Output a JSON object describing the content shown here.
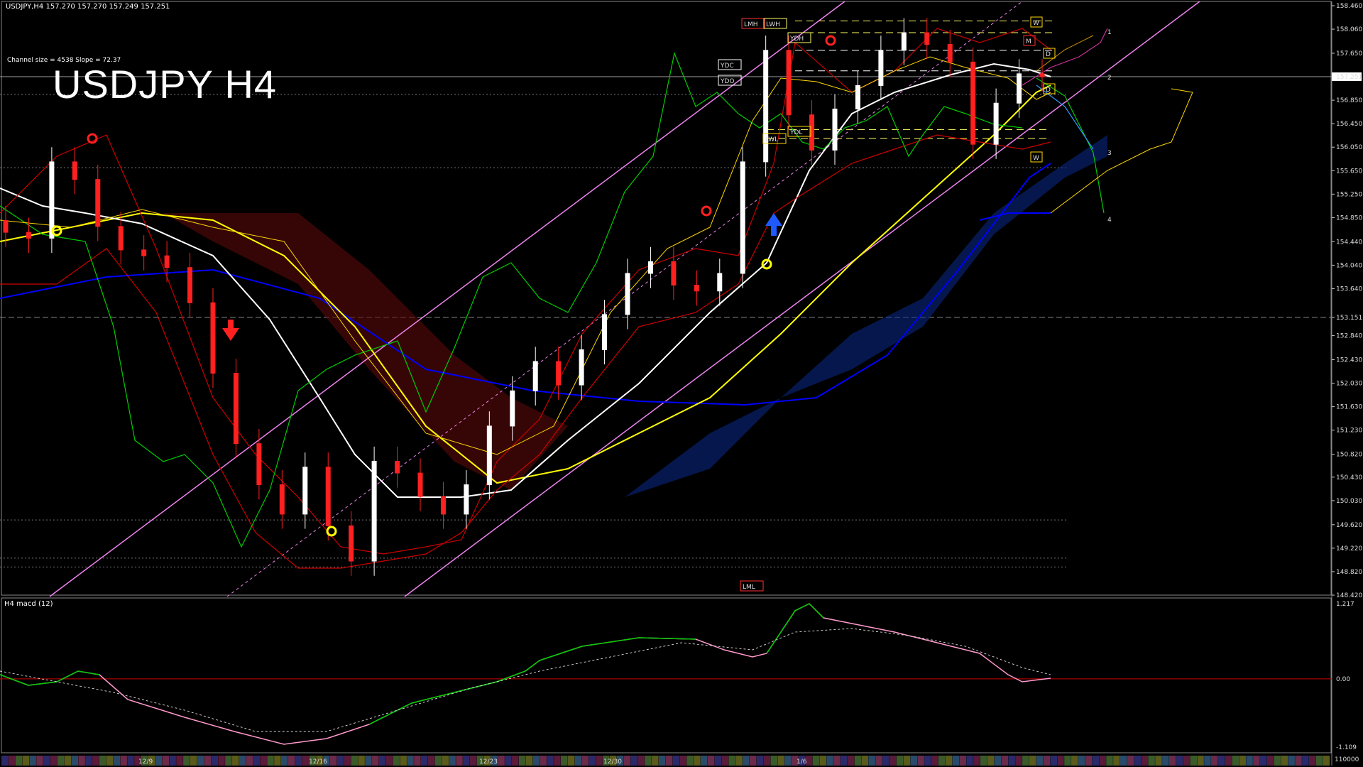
{
  "header": {
    "symbol_line": "USDJPY,H4  157.270 157.270 157.249 157.251",
    "channel_info": "Channel size = 4538 Slope = 72.37",
    "big_title": "USDJPY H4"
  },
  "price_axis": {
    "ticks": [
      "158.460",
      "158.060",
      "157.650",
      "157.251",
      "156.850",
      "156.450",
      "156.050",
      "155.650",
      "155.250",
      "154.850",
      "154.440",
      "154.040",
      "153.640",
      "153.151",
      "152.840",
      "152.430",
      "152.030",
      "151.630",
      "151.230",
      "150.820",
      "150.430",
      "150.030",
      "149.620",
      "149.220",
      "148.820",
      "148.420"
    ],
    "current_price": "157.251",
    "ref_price": "153.151"
  },
  "macd_panel": {
    "label": "H4  macd (12)",
    "ticks": [
      "1.217",
      "0.00",
      "-1.109"
    ],
    "volume_label": "110000"
  },
  "time_axis": {
    "labels": [
      "12/9",
      "12/16",
      "12/23",
      "12/30",
      "1/6"
    ]
  },
  "markers": {
    "lmh": "LMH",
    "lwh": "LWH",
    "ydh": "YDH",
    "ydc": "YDC",
    "ydo": "YDO",
    "lwl": "LWL",
    "ydl": "YDL",
    "lml": "LML",
    "w": "W",
    "m": "M",
    "d": "D",
    "wave": [
      "1",
      "2",
      "3",
      "4"
    ]
  },
  "colors": {
    "bull": "#ffffff",
    "bear": "#ff0000",
    "ma_white": "#ffffff",
    "ma_yellow": "#ffff00",
    "ma_blue": "#0000ff",
    "channel": "#ee82ee",
    "green": "#00cc00",
    "cloud": "#1e5aff"
  },
  "chart_data": {
    "type": "candlestick",
    "y_axis_range": [
      148.42,
      158.46
    ],
    "x": [
      "12/9",
      "12/16",
      "12/23",
      "12/30",
      "1/6"
    ],
    "close_points": [
      154.6,
      154.5,
      155.8,
      155.5,
      154.7,
      154.3,
      154.2,
      154.0,
      153.4,
      152.2,
      151.0,
      150.3,
      149.8,
      150.6,
      149.6,
      149.0,
      150.7,
      150.5,
      150.1,
      149.8,
      150.3,
      151.3,
      151.9,
      152.4,
      152.0,
      152.6,
      153.2,
      153.9,
      154.1,
      153.7,
      153.6,
      153.9,
      155.8,
      157.7,
      156.6,
      156.0,
      156.7,
      157.1,
      157.7,
      158.0,
      157.8,
      157.5,
      156.1,
      156.8,
      157.3,
      157.25
    ],
    "macd_range": [
      -1.109,
      1.217
    ]
  }
}
